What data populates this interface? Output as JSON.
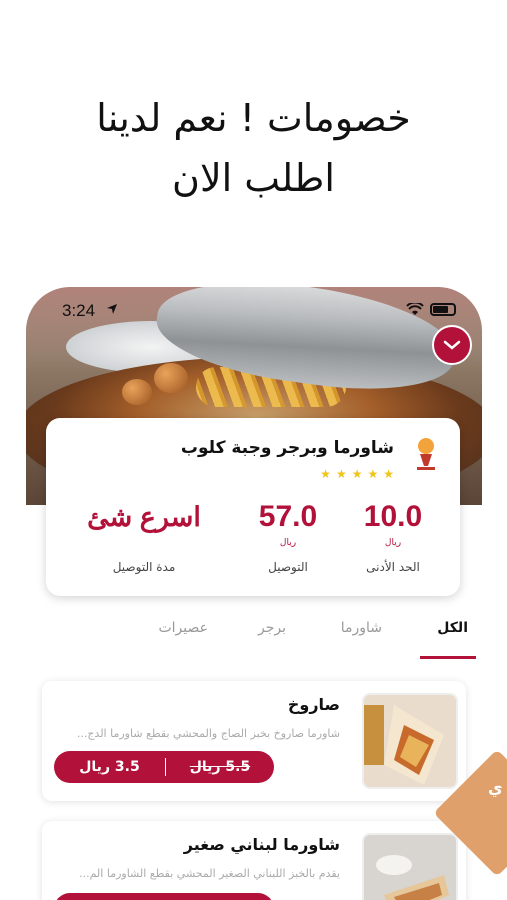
{
  "headline": {
    "line1": "خصومات ! نعم لدينا",
    "line2": "اطلب الان"
  },
  "status_bar": {
    "time": "3:24"
  },
  "restaurant": {
    "name": "شاورما وبرجر وجبة كلوب",
    "rating_stars": 5,
    "metrics": [
      {
        "value": "10.0",
        "unit": "ريال",
        "label": "الحد الأدنى"
      },
      {
        "value": "57.0",
        "unit": "ريال",
        "label": "التوصيل"
      },
      {
        "value": "اسرع شئ",
        "unit": "",
        "label": "مدة التوصيل"
      }
    ]
  },
  "tabs": [
    {
      "label": "الكل",
      "active": true
    },
    {
      "label": "شاورما",
      "active": false
    },
    {
      "label": "برجر",
      "active": false
    },
    {
      "label": "عصيرات",
      "active": false
    }
  ],
  "items": [
    {
      "title": "صاروخ",
      "description": "شاورما صاروخ بخبز الصاج والمحشي بقطع شاورما الدج...",
      "old_price": "5.5 ريال",
      "new_price": "3.5 ريال"
    },
    {
      "title": "شاورما لبناني صغير",
      "description": "يقدم بالخبز اللبناني الصغير المحشي بقطع الشاورما الم..."
    }
  ],
  "side_tag": {
    "text": "ي"
  },
  "colors": {
    "accent": "#b2123a",
    "star": "#f0c419",
    "tag": "#e0a06b"
  },
  "icons": {
    "collapse": "chevron-down-icon",
    "location": "location-arrow-icon",
    "wifi": "wifi-icon",
    "battery": "battery-icon",
    "logo": "restaurant-logo-icon"
  }
}
